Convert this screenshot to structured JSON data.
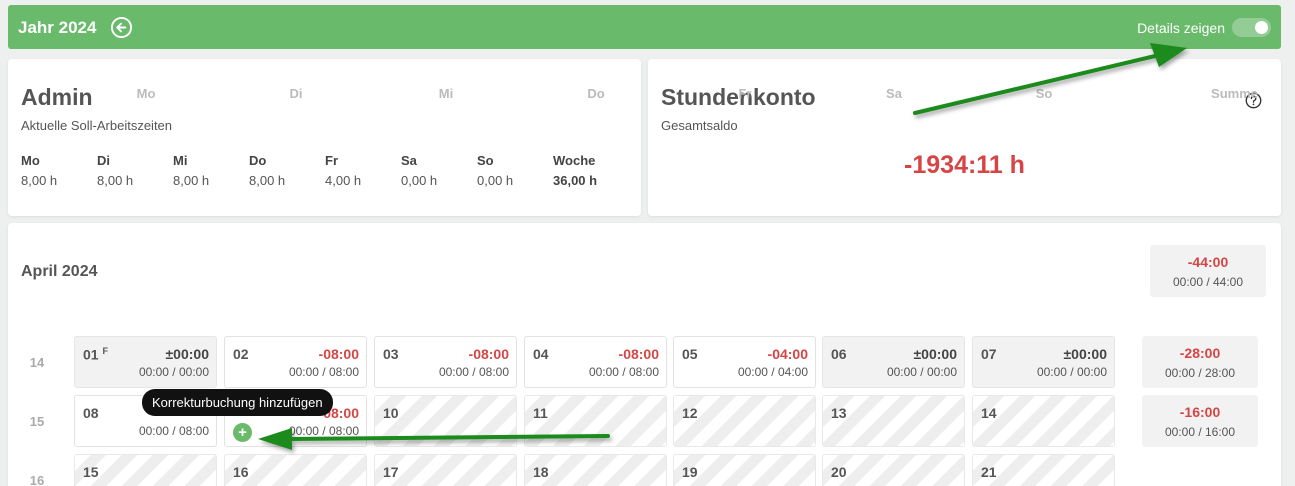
{
  "header": {
    "title": "Jahr 2024",
    "details_label": "Details zeigen",
    "details_on": true,
    "accent": "#6aba6c"
  },
  "admin": {
    "name": "Admin",
    "subtitle": "Aktuelle Soll-Arbeitszeiten",
    "week": [
      {
        "day": "Mo",
        "hours": "8,00 h"
      },
      {
        "day": "Di",
        "hours": "8,00 h"
      },
      {
        "day": "Mi",
        "hours": "8,00 h"
      },
      {
        "day": "Do",
        "hours": "8,00 h"
      },
      {
        "day": "Fr",
        "hours": "4,00 h"
      },
      {
        "day": "Sa",
        "hours": "0,00 h"
      },
      {
        "day": "So",
        "hours": "0,00 h"
      },
      {
        "day": "Woche",
        "hours": "36,00 h"
      }
    ]
  },
  "stundenkonto": {
    "title": "Stundenkonto",
    "subtitle": "Gesamtsaldo",
    "value": "-1934:11 h",
    "value_color": "#d64545"
  },
  "month": {
    "title": "April 2024",
    "summary": {
      "balance": "-44:00",
      "hours": "00:00 / 44:00"
    },
    "weekdays": [
      "Mo",
      "Di",
      "Mi",
      "Do",
      "Fr",
      "Sa",
      "So"
    ],
    "sum_label": "Summe",
    "weeks": [
      {
        "week": "14",
        "days": [
          {
            "day": "01",
            "marker": "F",
            "balance": "±00:00",
            "hours": "00:00 / 00:00",
            "style": "gray"
          },
          {
            "day": "02",
            "balance": "-08:00",
            "hours": "00:00 / 08:00",
            "style": "normal"
          },
          {
            "day": "03",
            "balance": "-08:00",
            "hours": "00:00 / 08:00",
            "style": "normal"
          },
          {
            "day": "04",
            "balance": "-08:00",
            "hours": "00:00 / 08:00",
            "style": "normal"
          },
          {
            "day": "05",
            "balance": "-04:00",
            "hours": "00:00 / 04:00",
            "style": "normal"
          },
          {
            "day": "06",
            "balance": "±00:00",
            "hours": "00:00 / 00:00",
            "style": "gray"
          },
          {
            "day": "07",
            "balance": "±00:00",
            "hours": "00:00 / 00:00",
            "style": "gray"
          }
        ],
        "sum": {
          "balance": "-28:00",
          "hours": "00:00 / 28:00"
        }
      },
      {
        "week": "15",
        "days": [
          {
            "day": "08",
            "balance": "",
            "hours": "00:00 / 08:00",
            "style": "normal"
          },
          {
            "day": "",
            "balance": "-08:00",
            "hours": "00:00 / 08:00",
            "style": "normal"
          },
          {
            "day": "10",
            "style": "hatch"
          },
          {
            "day": "11",
            "style": "hatch"
          },
          {
            "day": "12",
            "style": "hatch"
          },
          {
            "day": "13",
            "style": "hatch"
          },
          {
            "day": "14",
            "style": "hatch"
          }
        ],
        "sum": {
          "balance": "-16:00",
          "hours": "00:00 / 16:00"
        }
      },
      {
        "week": "16",
        "days": [
          {
            "day": "15",
            "style": "hatch"
          },
          {
            "day": "16",
            "style": "hatch"
          },
          {
            "day": "17",
            "style": "hatch"
          },
          {
            "day": "18",
            "style": "hatch"
          },
          {
            "day": "19",
            "style": "hatch"
          },
          {
            "day": "20",
            "style": "hatch"
          },
          {
            "day": "21",
            "style": "hatch"
          }
        ]
      }
    ]
  },
  "tooltip": {
    "text": "Korrekturbuchung hinzufügen"
  },
  "add_button": {
    "label": "+"
  }
}
